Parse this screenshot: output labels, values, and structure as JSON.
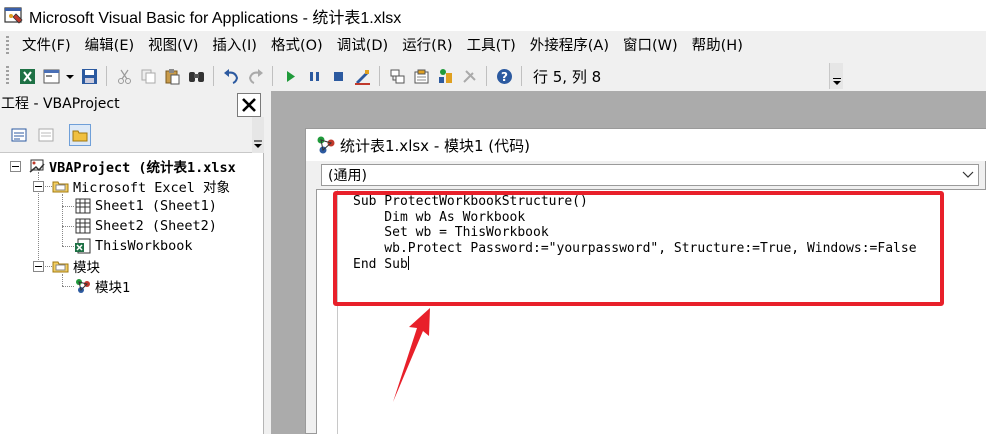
{
  "window": {
    "title": "Microsoft Visual Basic for Applications - 统计表1.xlsx"
  },
  "menu": [
    "文件(F)",
    "编辑(E)",
    "视图(V)",
    "插入(I)",
    "格式(O)",
    "调试(D)",
    "运行(R)",
    "工具(T)",
    "外接程序(A)",
    "窗口(W)",
    "帮助(H)"
  ],
  "toolbar": {
    "cursor_position": "行 5, 列 8"
  },
  "project_pane": {
    "title": "工程 - VBAProject",
    "close_glyph": "✕",
    "tree": {
      "root": "VBAProject (统计表1.xlsx",
      "excel_objects": "Microsoft Excel 对象",
      "sheet1": "Sheet1 (Sheet1)",
      "sheet2": "Sheet2 (Sheet2)",
      "thisworkbook": "ThisWorkbook",
      "modules": "模块",
      "module1": "模块1"
    }
  },
  "code_window": {
    "title": "统计表1.xlsx - 模块1 (代码)",
    "object_combo": "(通用)",
    "code_lines": [
      "Sub ProtectWorkbookStructure()",
      "    Dim wb As Workbook",
      "    Set wb = ThisWorkbook",
      "    wb.Protect Password:=\"yourpassword\", Structure:=True, Windows:=False",
      "End Sub"
    ]
  },
  "annotation": {
    "color": "#e8202a"
  }
}
